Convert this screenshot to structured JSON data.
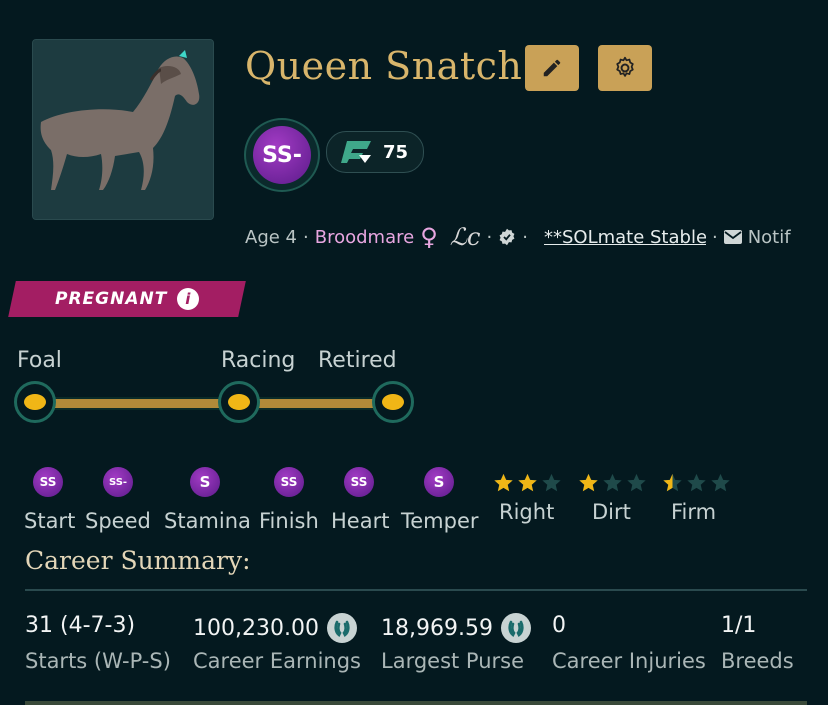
{
  "horse": {
    "name": "Queen Snatch",
    "grade": "SS-",
    "rating": "75",
    "age": "Age 4",
    "type": "Broodmare",
    "owner": "**SOLmate Stable",
    "notify_label": "Notif"
  },
  "status": {
    "label": "PREGNANT",
    "info": "i"
  },
  "lifecycle": {
    "stages": [
      "Foal",
      "Racing",
      "Retired"
    ]
  },
  "stats": [
    {
      "grade": "SS",
      "label": "Start"
    },
    {
      "grade": "SS-",
      "label": "Speed"
    },
    {
      "grade": "S",
      "label": "Stamina"
    },
    {
      "grade": "SS",
      "label": "Finish"
    },
    {
      "grade": "SS",
      "label": "Heart"
    },
    {
      "grade": "S",
      "label": "Temper"
    }
  ],
  "preferences": [
    {
      "label": "Right",
      "stars": 2,
      "max": 3
    },
    {
      "label": "Dirt",
      "stars": 1,
      "max": 3
    },
    {
      "label": "Firm",
      "stars": 0.5,
      "max": 3
    }
  ],
  "summary": {
    "title": "Career Summary:",
    "items": [
      {
        "value": "31 (4-7-3)",
        "label": "Starts (W-P-S)"
      },
      {
        "value": "100,230.00",
        "label": "Career Earnings"
      },
      {
        "value": "18,969.59",
        "label": "Largest Purse"
      },
      {
        "value": "0",
        "label": "Career Injuries"
      },
      {
        "value": "1/1",
        "label": "Breeds"
      }
    ]
  },
  "colors": {
    "background": "#04191f",
    "gold": "#c9a157",
    "pregnant": "#a31e63",
    "broodmare": "#e8a6e0",
    "grade_purple": "#7a2aa8",
    "star_gold": "#f0b616",
    "star_empty": "#1f4a4a"
  }
}
